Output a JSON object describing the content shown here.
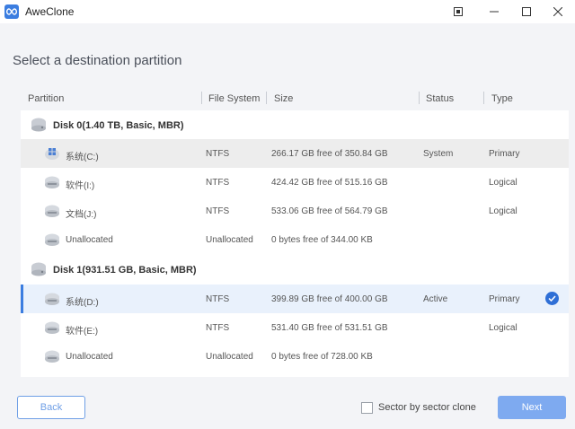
{
  "window": {
    "title": "AweClone",
    "logo_icon": "infinity-icon",
    "controls": [
      "pin-icon",
      "minimize-icon",
      "maximize-icon",
      "close-icon"
    ]
  },
  "page": {
    "title": "Select a destination partition"
  },
  "table": {
    "headers": {
      "partition": "Partition",
      "file_system": "File System",
      "size": "Size",
      "status": "Status",
      "type": "Type"
    },
    "disks": [
      {
        "label": "Disk 0(1.40 TB, Basic, MBR)",
        "icon": "disk-icon",
        "partitions": [
          {
            "name": "系统(C:)",
            "icon": "windows-drive-icon",
            "fs": "NTFS",
            "size": "266.17 GB free of 350.84 GB",
            "status": "System",
            "type": "Primary"
          },
          {
            "name": "软件(I:)",
            "icon": "drive-icon",
            "fs": "NTFS",
            "size": "424.42 GB free of 515.16 GB",
            "status": "",
            "type": "Logical"
          },
          {
            "name": "文档(J:)",
            "icon": "drive-icon",
            "fs": "NTFS",
            "size": "533.06 GB free of 564.79 GB",
            "status": "",
            "type": "Logical"
          },
          {
            "name": "Unallocated",
            "icon": "drive-icon",
            "fs": "Unallocated",
            "size": "0 bytes free of 344.00 KB",
            "status": "",
            "type": ""
          }
        ]
      },
      {
        "label": "Disk 1(931.51 GB, Basic, MBR)",
        "icon": "disk-icon",
        "partitions": [
          {
            "name": "系统(D:)",
            "icon": "drive-icon",
            "fs": "NTFS",
            "size": "399.89 GB free of 400.00 GB",
            "status": "Active",
            "type": "Primary"
          },
          {
            "name": "软件(E:)",
            "icon": "drive-icon",
            "fs": "NTFS",
            "size": "531.40 GB free of 531.51 GB",
            "status": "",
            "type": "Logical"
          },
          {
            "name": "Unallocated",
            "icon": "drive-icon",
            "fs": "Unallocated",
            "size": "0 bytes free of 728.00 KB",
            "status": "",
            "type": ""
          }
        ]
      }
    ]
  },
  "footer": {
    "back_label": "Back",
    "sector_clone_label": "Sector by sector clone",
    "sector_clone_checked": false,
    "next_label": "Next"
  },
  "colors": {
    "accent": "#3b7de0",
    "next_button": "#7eaaf0",
    "selected_row": "#e9f1fc",
    "highlight_row": "#ededed",
    "background": "#f3f4f7"
  }
}
